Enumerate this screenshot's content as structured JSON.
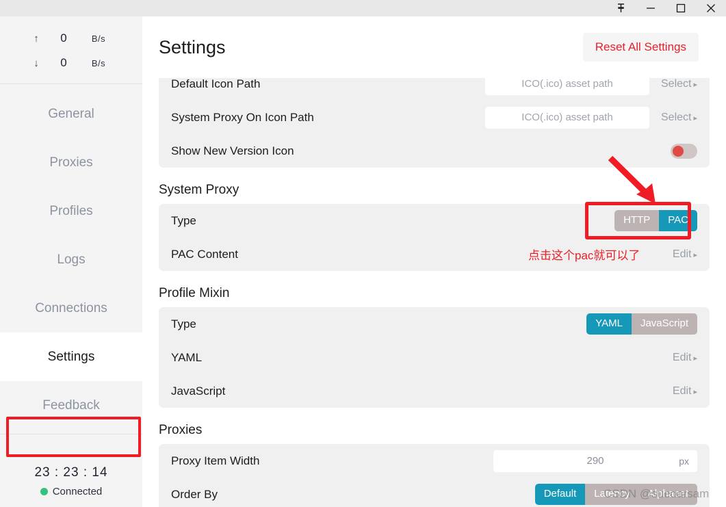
{
  "titlebar": {
    "buttons": [
      {
        "name": "pin-icon",
        "label": "Pin"
      },
      {
        "name": "minimize-icon",
        "label": "Minimize"
      },
      {
        "name": "maximize-icon",
        "label": "Maximize"
      },
      {
        "name": "close-icon",
        "label": "Close"
      }
    ]
  },
  "sidebar": {
    "speed": {
      "upload": {
        "arrow": "↑",
        "value": "0",
        "unit": "B/s"
      },
      "download": {
        "arrow": "↓",
        "value": "0",
        "unit": "B/s"
      }
    },
    "items": [
      {
        "label": "General",
        "active": false
      },
      {
        "label": "Proxies",
        "active": false
      },
      {
        "label": "Profiles",
        "active": false
      },
      {
        "label": "Logs",
        "active": false
      },
      {
        "label": "Connections",
        "active": false
      },
      {
        "label": "Settings",
        "active": true
      },
      {
        "label": "Feedback",
        "active": false
      }
    ],
    "status": {
      "uptime": "23 : 23 : 14",
      "connection": "Connected",
      "connection_color": "#35c17f"
    }
  },
  "header": {
    "title": "Settings",
    "reset_label": "Reset All Settings",
    "reset_color": "#e81f2a"
  },
  "sections": {
    "icons": {
      "rows": [
        {
          "label": "Default Icon Path",
          "placeholder": "ICO(.ico) asset path",
          "value": "",
          "action": "Select"
        },
        {
          "label": "System Proxy On Icon Path",
          "placeholder": "ICO(.ico) asset path",
          "value": "",
          "action": "Select"
        }
      ],
      "toggle_row": {
        "label": "Show New Version Icon",
        "state": "off",
        "knob_color": "#e04a45"
      }
    },
    "system_proxy": {
      "title": "System Proxy",
      "type_row": {
        "label": "Type",
        "options": [
          "HTTP",
          "PAC"
        ],
        "selected": "PAC"
      },
      "pac_row": {
        "label": "PAC Content",
        "action": "Edit"
      }
    },
    "profile_mixin": {
      "title": "Profile Mixin",
      "type_row": {
        "label": "Type",
        "options": [
          "YAML",
          "JavaScript"
        ],
        "selected": "YAML"
      },
      "rows": [
        {
          "label": "YAML",
          "action": "Edit"
        },
        {
          "label": "JavaScript",
          "action": "Edit"
        }
      ]
    },
    "proxies": {
      "title": "Proxies",
      "width_row": {
        "label": "Proxy Item Width",
        "value": "290",
        "unit": "px"
      },
      "order_row": {
        "label": "Order By",
        "options": [
          "Default",
          "Latency",
          "Alphabet"
        ],
        "selected": "Default"
      }
    }
  },
  "annotations": {
    "pac_note": "点击这个pac就可以了",
    "color": "#ef1c25"
  },
  "watermark": {
    "text": "CSDN @suedarsam"
  },
  "theme": {
    "accent": "#1698b8",
    "inactive_seg": "#bdb3b3",
    "card_bg": "#f0f0f0",
    "sidebar_bg": "#f4f4f4"
  }
}
